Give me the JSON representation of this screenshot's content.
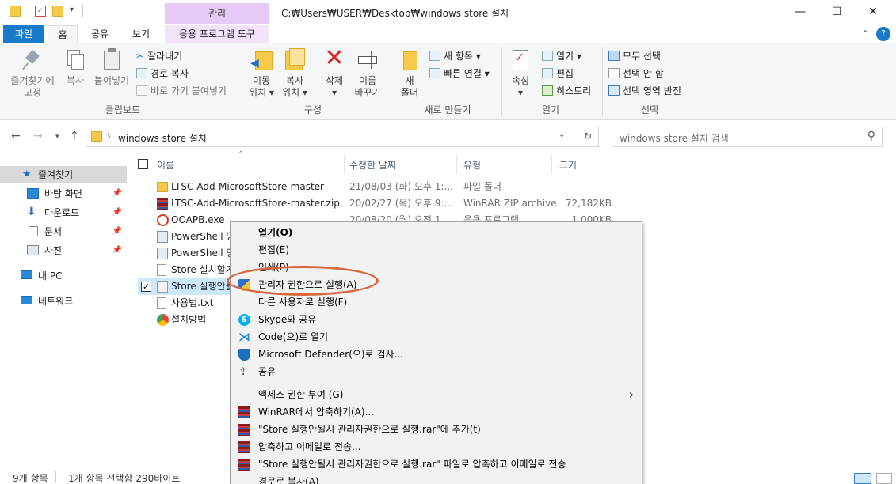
{
  "window": {
    "path_title": "C:₩Users₩USER₩Desktop₩windows store 설치",
    "context_tab_header": "관리",
    "controls": {
      "minimize": "—",
      "maximize": "☐",
      "close": "✕"
    }
  },
  "tabs": {
    "file": "파일",
    "home": "홈",
    "share": "공유",
    "view": "보기",
    "app_tools": "응용 프로그램 도구",
    "expand": "⌃",
    "help": "?"
  },
  "ribbon": {
    "clipboard": {
      "pin": "즐겨찾기에\n고정",
      "copy": "복사",
      "paste": "붙여넣기",
      "cut": "잘라내기",
      "copy_path": "경로 복사",
      "paste_shortcut": "바로 가기 붙여넣기",
      "label": "클립보드"
    },
    "organize": {
      "move_to": "이동\n위치 ▾",
      "copy_to": "복사\n위치 ▾",
      "delete": "삭제\n▾",
      "rename": "이름\n바꾸기",
      "label": "구성"
    },
    "new": {
      "new_folder": "새\n폴더",
      "new_item": "새 항목 ▾",
      "easy_access": "빠른 연결 ▾",
      "label": "새로 만들기"
    },
    "open": {
      "properties": "속성\n▾",
      "open": "열기 ▾",
      "edit": "편집",
      "history": "히스토리",
      "label": "열기"
    },
    "select": {
      "select_all": "모두 선택",
      "select_none": "선택 안 함",
      "invert": "선택 영역 반전",
      "label": "선택"
    }
  },
  "nav": {
    "address": "windows store 설치",
    "search_placeholder": "windows store 설치 검색"
  },
  "navpane": {
    "quick_access": "즐겨찾기",
    "desktop": "바탕 화면",
    "downloads": "다운로드",
    "documents": "문서",
    "pictures": "사진",
    "this_pc": "내 PC",
    "network": "네트워크"
  },
  "columns": {
    "name": "이름",
    "date": "수정한 날짜",
    "type": "유형",
    "size": "크기"
  },
  "files": [
    {
      "name": "LTSC-Add-MicrosoftStore-master",
      "date": "21/08/03 (화) 오후 1:...",
      "type": "파일 폴더",
      "size": ""
    },
    {
      "name": "LTSC-Add-MicrosoftStore-master.zip",
      "date": "20/02/27 (목) 오후 9:...",
      "type": "WinRAR ZIP archive",
      "size": "72,182KB"
    },
    {
      "name": "OOAPB.exe",
      "date": "20/08/20 (월) 오전 1...",
      "type": "응용 프로그램",
      "size": "1,000KB"
    },
    {
      "name": "PowerShell 명",
      "date": "",
      "type": "",
      "size": ""
    },
    {
      "name": "PowerShell 명",
      "date": "",
      "type": "",
      "size": ""
    },
    {
      "name": "Store 설치할기",
      "date": "",
      "type": "",
      "size": ""
    },
    {
      "name": "Store 실행안될",
      "date": "",
      "type": "",
      "size": ""
    },
    {
      "name": "사용법.txt",
      "date": "",
      "type": "",
      "size": ""
    },
    {
      "name": "설치방법",
      "date": "",
      "type": "",
      "size": ""
    }
  ],
  "status": {
    "count": "9개 항목",
    "selection": "1개 항목 선택함 290바이트"
  },
  "context_menu": [
    {
      "label": "열기(O)",
      "bold": true,
      "icon": ""
    },
    {
      "label": "편집(E)",
      "icon": ""
    },
    {
      "label": "인쇄(P)",
      "icon": ""
    },
    {
      "label": "관리자 권한으로 실행(A)",
      "icon": "shield-icon"
    },
    {
      "label": "다른 사용자로 실행(F)",
      "icon": ""
    },
    {
      "label": "Skype와 공유",
      "icon": "skype-icon"
    },
    {
      "label": "Code(으)로 열기",
      "icon": "vscode-icon"
    },
    {
      "label": "Microsoft Defender(으)로 검사...",
      "icon": "defender-icon"
    },
    {
      "label": "공유",
      "icon": "share-icon"
    },
    {
      "label": "액세스 권한 부여 (G)",
      "icon": "",
      "submenu": "›"
    },
    {
      "label": "WinRAR에서 압축하기(A)...",
      "icon": "winrar-icon"
    },
    {
      "label": "\"Store 실행안될시 관리자권한으로 실행.rar\"에 추가(t)",
      "icon": "winrar-icon"
    },
    {
      "label": "압축하고 이메일로 전송...",
      "icon": "winrar-icon"
    },
    {
      "label": "\"Store 실행안될시 관리자권한으로 실행.rar\" 파일로 압축하고 이메일로 전송",
      "icon": "winrar-icon"
    },
    {
      "label": "경로로 복사(A)",
      "icon": ""
    }
  ],
  "colors": {
    "accent": "#1979ca",
    "highlight": "#d8683f",
    "context_tab": "#e7c9f5"
  }
}
